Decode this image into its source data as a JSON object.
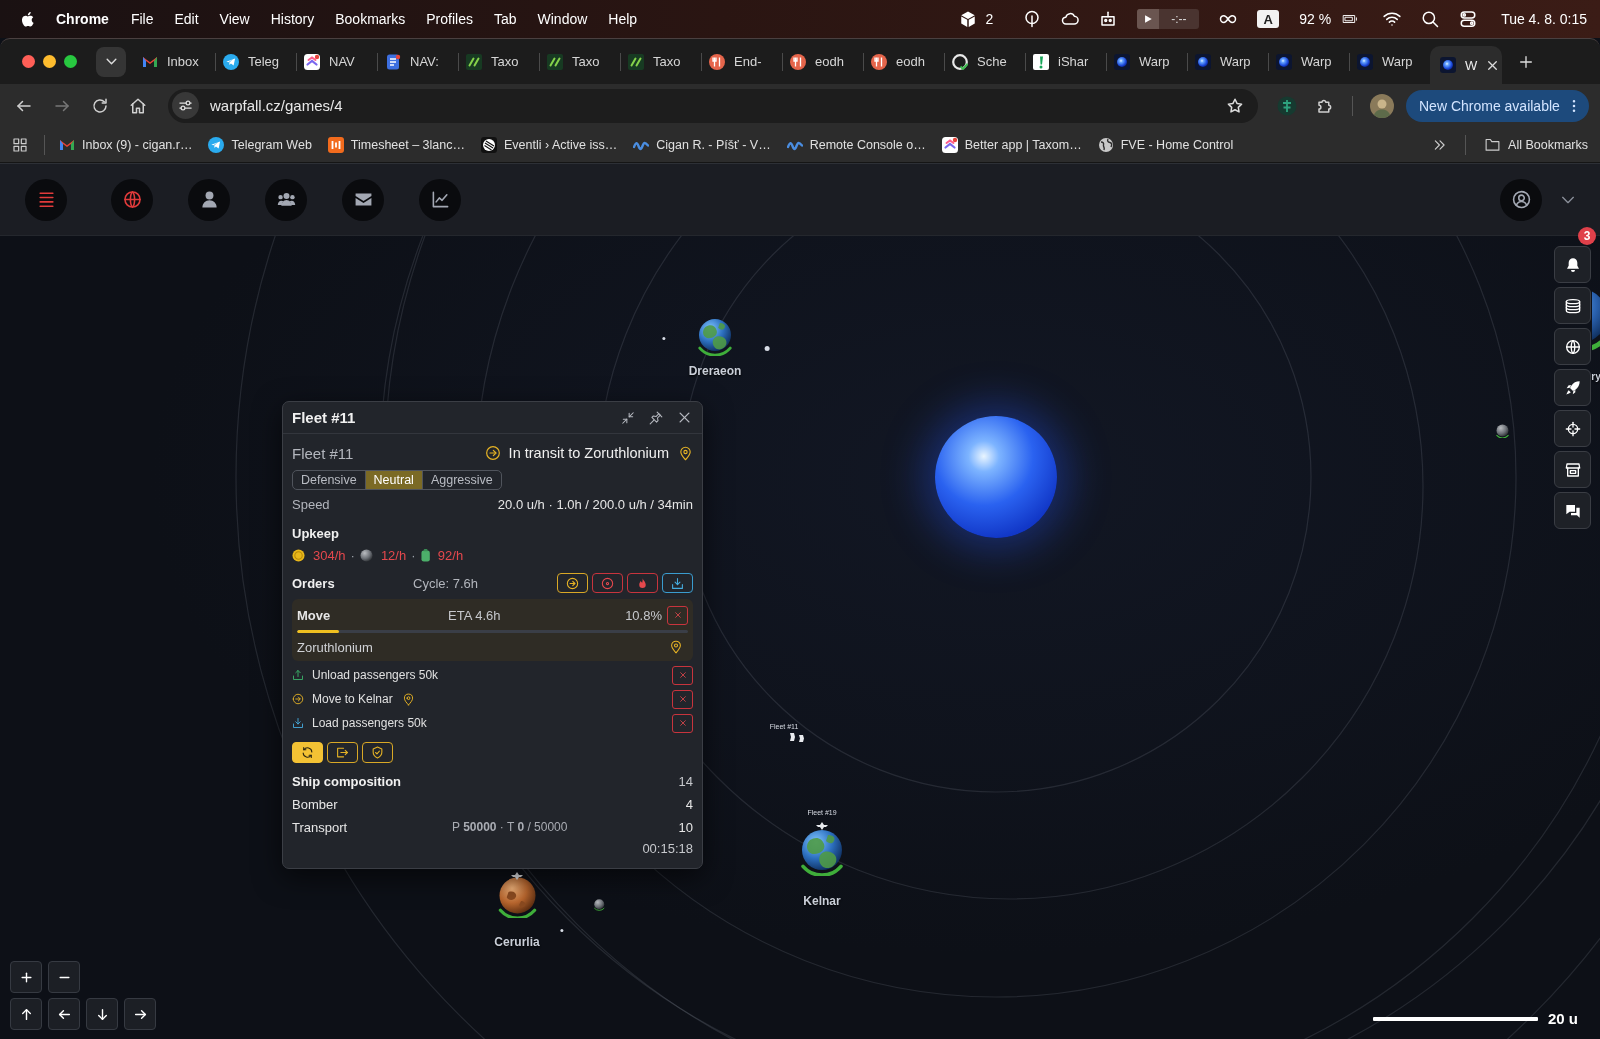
{
  "menu_bar": {
    "app_name": "Chrome",
    "menus": [
      "File",
      "Edit",
      "View",
      "History",
      "Bookmarks",
      "Profiles",
      "Tab",
      "Window",
      "Help"
    ],
    "status_items": [
      {
        "kind": "cube",
        "text": "2"
      },
      {
        "kind": "keyhole"
      },
      {
        "kind": "cloud"
      },
      {
        "kind": "robot"
      },
      {
        "kind": "media",
        "text": "-:--"
      },
      {
        "kind": "infinity"
      },
      {
        "kind": "input",
        "text": "A"
      },
      {
        "kind": "battery",
        "text": "92 %"
      },
      {
        "kind": "wifi"
      },
      {
        "kind": "search"
      },
      {
        "kind": "toggles"
      },
      {
        "kind": "clock",
        "text": "Tue 4. 8. 0:15"
      }
    ]
  },
  "browser": {
    "tabs": [
      {
        "kind": "mail",
        "title": "Inbox",
        "selected": false
      },
      {
        "kind": "plane",
        "title": "Teleg",
        "selected": false
      },
      {
        "kind": "chevron",
        "title": "NAV",
        "selected": false
      },
      {
        "kind": "doc",
        "title": "NAV:",
        "selected": false
      },
      {
        "kind": "slash",
        "title": "Taxo",
        "selected": false
      },
      {
        "kind": "slash",
        "title": "Taxo",
        "selected": false
      },
      {
        "kind": "slash",
        "title": "Taxo",
        "selected": false
      },
      {
        "kind": "fork",
        "title": "End-",
        "selected": false
      },
      {
        "kind": "fork",
        "title": "eodh",
        "selected": false
      },
      {
        "kind": "fork",
        "title": "eodh",
        "selected": false
      },
      {
        "kind": "octo",
        "title": "Sche",
        "selected": false
      },
      {
        "kind": "exclaim",
        "title": "iShar",
        "selected": false
      },
      {
        "kind": "orb",
        "title": "Warp",
        "selected": false
      },
      {
        "kind": "orb",
        "title": "Warp",
        "selected": false
      },
      {
        "kind": "orb",
        "title": "Warp",
        "selected": false
      },
      {
        "kind": "orb",
        "title": "Warp",
        "selected": false
      },
      {
        "kind": "orb",
        "title": "W",
        "selected": true
      }
    ],
    "address": "warpfall.cz/games/4",
    "update_button": "New Chrome available",
    "bookmarks": [
      {
        "kind": "mail",
        "title": "Inbox (9) - cigan.r…"
      },
      {
        "kind": "plane",
        "title": "Telegram Web"
      },
      {
        "kind": "bars",
        "title": "Timesheet – 3lanc…"
      },
      {
        "kind": "stripes",
        "title": "Eventli › Active iss…"
      },
      {
        "kind": "wave",
        "title": "Cigan R. - Píšť - V…"
      },
      {
        "kind": "wave",
        "title": "Remote Console o…"
      },
      {
        "kind": "chevron",
        "title": "Better app | Taxom…"
      },
      {
        "kind": "globe",
        "title": "FVE - Home Control"
      }
    ],
    "all_bookmarks": "All Bookmarks"
  },
  "game": {
    "toolbar": [
      {
        "kind": "menu",
        "highlighted": true
      },
      {
        "kind": "globe",
        "highlighted": true
      },
      {
        "kind": "person",
        "highlighted": false
      },
      {
        "kind": "group",
        "highlighted": false
      },
      {
        "kind": "envelope",
        "highlighted": false
      },
      {
        "kind": "chart",
        "highlighted": false
      }
    ],
    "map": {
      "bodies": [
        {
          "kind": "earth",
          "name": "Dreraeon",
          "owned": true,
          "docked_fleet": false
        },
        {
          "kind": "dust",
          "owned": false,
          "docked_fleet": false
        },
        {
          "kind": "dust",
          "owned": false,
          "docked_fleet": false
        },
        {
          "kind": "ocean",
          "name": "ry",
          "owned": true,
          "docked_fleet": false
        },
        {
          "kind": "rock",
          "owned": true,
          "docked_fleet": false
        },
        {
          "kind": "earth",
          "name": "Kelnar",
          "owned": true,
          "docked_fleet": true,
          "fleet_label": "Fleet #19"
        },
        {
          "kind": "desert",
          "name": "Cerurlia",
          "owned": true,
          "docked_fleet": true
        },
        {
          "kind": "rock",
          "owned": true,
          "docked_fleet": false
        },
        {
          "kind": "dust",
          "owned": false,
          "docked_fleet": false
        }
      ],
      "fleets": [
        {
          "label": "Fleet #11"
        }
      ],
      "scale": "20 u"
    },
    "sidebar": [
      {
        "kind": "bell",
        "badge": "3"
      },
      {
        "kind": "coins"
      },
      {
        "kind": "globe"
      },
      {
        "kind": "rocket"
      },
      {
        "kind": "crosshair"
      },
      {
        "kind": "store"
      },
      {
        "kind": "chat"
      }
    ],
    "zoom_buttons": [
      {
        "kind": "plus"
      },
      {
        "kind": "minus"
      }
    ],
    "pan_buttons": [
      {
        "kind": "up"
      },
      {
        "kind": "left"
      },
      {
        "kind": "down"
      },
      {
        "kind": "right"
      }
    ],
    "fleet_window": {
      "title": "Fleet #11",
      "name": "Fleet #11",
      "status": "In transit to Zoruthlonium",
      "stances": [
        {
          "label": "Defensive",
          "selected": false
        },
        {
          "label": "Neutral",
          "selected": true
        },
        {
          "label": "Aggressive",
          "selected": false
        }
      ],
      "speed_label": "Speed",
      "speed": "20.0 u/h · 1.0h / 200.0 u/h / 34min",
      "upkeep_title": "Upkeep",
      "upkeep": [
        {
          "kind": "credits",
          "amount": "304/h",
          "separator": "·"
        },
        {
          "kind": "ore",
          "amount": "12/h",
          "separator": "·"
        },
        {
          "kind": "fuel",
          "amount": "92/h"
        }
      ],
      "orders_title": "Orders",
      "cycle": "Cycle: 7.6h",
      "order_actions": [
        {
          "kind": "move"
        },
        {
          "kind": "attack"
        },
        {
          "kind": "burn"
        },
        {
          "kind": "load"
        }
      ],
      "current_order": {
        "label": "Move",
        "eta": "ETA 4.6h",
        "percent": "10.8%",
        "level": 0.108,
        "target": "Zoruthlonium"
      },
      "queue": [
        {
          "kind": "unload",
          "label": "Unload passengers 50k",
          "pin": false
        },
        {
          "kind": "move",
          "label": "Move to Kelnar",
          "pin": true
        },
        {
          "kind": "load",
          "label": "Load passengers 50k",
          "pin": false
        }
      ],
      "modes": [
        {
          "kind": "repeat",
          "on": true
        },
        {
          "kind": "exit",
          "on": false
        },
        {
          "kind": "shield",
          "on": false
        }
      ],
      "composition_title": "Ship composition",
      "composition_total": "14",
      "ships": [
        {
          "name": "Bomber",
          "count": "4"
        },
        {
          "name": "Transport",
          "cargo": "P **50000** · T **0** / 50000",
          "count": "10"
        }
      ],
      "timer": "00:15:18"
    }
  }
}
